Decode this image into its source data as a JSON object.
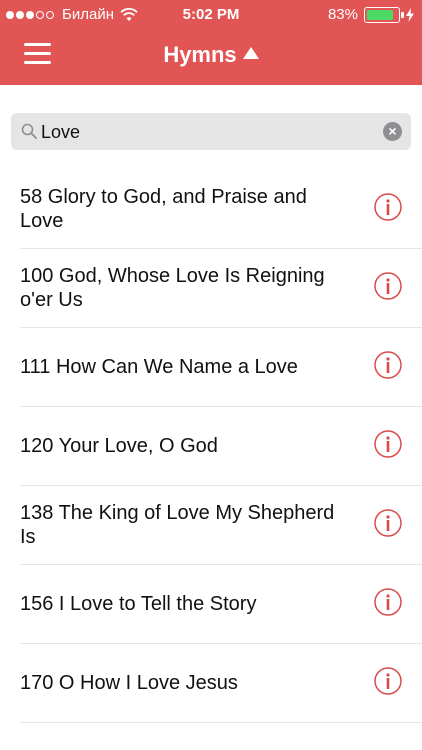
{
  "status_bar": {
    "carrier": "Билайн",
    "time": "5:02 PM",
    "battery_percent": "83%",
    "battery_level": 0.83,
    "signal_bars_filled": 3,
    "signal_bars_total": 5
  },
  "header": {
    "title": "Hymns",
    "background_color": "#e25555",
    "accent_color": "#d0393b"
  },
  "search": {
    "value": "Love",
    "placeholder": ""
  },
  "hymns": [
    {
      "label": "58 Glory to God, and Praise and Love"
    },
    {
      "label": "100 God, Whose Love Is Reigning o'er Us"
    },
    {
      "label": "111 How Can We Name a Love"
    },
    {
      "label": "120 Your Love, O God"
    },
    {
      "label": "138 The King of Love My Shepherd Is"
    },
    {
      "label": "156 I Love to Tell the Story"
    },
    {
      "label": "170 O How I Love Jesus"
    }
  ],
  "icons": {
    "menu": "hamburger-icon",
    "sort": "triangle-up-icon",
    "search": "magnifier-icon",
    "clear": "clear-x-icon",
    "info": "info-icon"
  }
}
